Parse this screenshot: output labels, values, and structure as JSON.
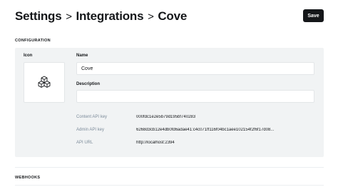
{
  "breadcrumb": {
    "items": [
      "Settings",
      "Integrations",
      "Cove"
    ],
    "separator": ">"
  },
  "toolbar": {
    "save_label": "Save"
  },
  "configuration": {
    "heading": "CONFIGURATION",
    "icon_label": "Icon",
    "icon_name": "cubes-icon",
    "name_label": "Name",
    "name_value": "Cove",
    "description_label": "Description",
    "description_value": "",
    "rows": [
      {
        "key": "Content API key",
        "value": "000fdc1e2e5b79d195bf740283"
      },
      {
        "key": "Admin API key",
        "value": "6268d3cb12e4db0fd6adae41:c4c071ff116f04bc1aee102154f2f6f17d08..."
      },
      {
        "key": "API URL",
        "value": "http://localhost:2394"
      }
    ]
  },
  "webhooks": {
    "heading": "WEBHOOKS"
  },
  "colors": {
    "accent": "#15171a",
    "panel_bg": "#f1f3f4",
    "muted_text": "#7c8b9a"
  }
}
